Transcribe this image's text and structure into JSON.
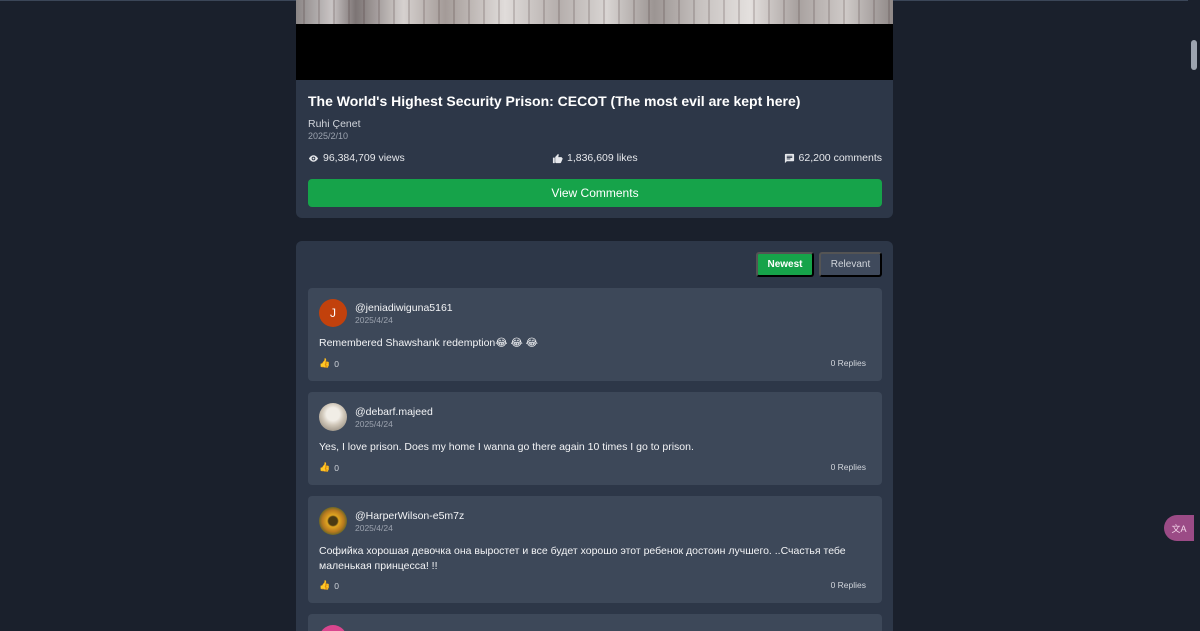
{
  "video": {
    "title": "The World's Highest Security Prison: CECOT (The most evil are kept here)",
    "channel": "Ruhi Çenet",
    "date": "2025/2/10",
    "views": "96,384,709 views",
    "likes": "1,836,609 likes",
    "comments": "62,200 comments",
    "view_comments_label": "View Comments"
  },
  "sort": {
    "newest_label": "Newest",
    "relevant_label": "Relevant",
    "active": "Newest"
  },
  "comments": [
    {
      "avatar_letter": "J",
      "user": "@jeniadiwiguna5161",
      "date": "2025/4/24",
      "text": "Remembered Shawshank redemption😂 😂 😂",
      "likes": "0",
      "replies": "0 Replies"
    },
    {
      "avatar_letter": "",
      "user": "@debarf.majeed",
      "date": "2025/4/24",
      "text": "Yes, I love prison. Does my home I wanna go there again 10 times I go to prison.",
      "likes": "0",
      "replies": "0 Replies"
    },
    {
      "avatar_letter": "",
      "user": "@HarperWilson-e5m7z",
      "date": "2025/4/24",
      "text": "Софийка хорошая девочка она выростет и все будет хорошо этот ребенок достоин лучшего. ..Счастья тебе маленькая принцесса! !!",
      "likes": "0",
      "replies": "0 Replies"
    }
  ],
  "icons": {
    "like": "👍",
    "translate": "文A"
  },
  "colors": {
    "background": "#1a202c",
    "card": "#2d3748",
    "comment": "#3d4859",
    "accent": "#16a34a"
  }
}
